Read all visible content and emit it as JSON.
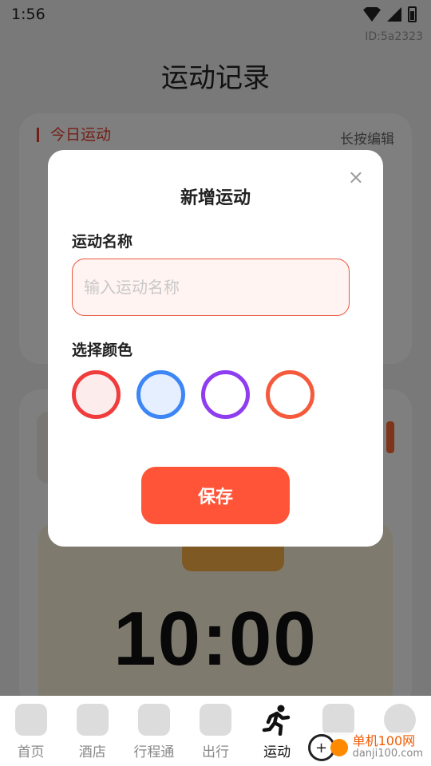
{
  "status_bar": {
    "time": "1:56"
  },
  "device_id": "ID:5a2323",
  "page": {
    "title": "运动记录",
    "card_today": {
      "title": "今日运动",
      "hint": "长按编辑"
    },
    "timer": {
      "value": "10:00"
    }
  },
  "modal": {
    "title": "新增运动",
    "close_symbol": "×",
    "name_label": "运动名称",
    "name_placeholder": "输入运动名称",
    "name_value": "",
    "color_label": "选择颜色",
    "colors": [
      {
        "border": "#f03c3c",
        "fill": "#fdecec",
        "selected": false
      },
      {
        "border": "#3d86f5",
        "fill": "#e6efff",
        "selected": false
      },
      {
        "border": "#8e3df0",
        "fill": "#ffffff",
        "selected": false
      },
      {
        "border": "#f55a3c",
        "fill": "#ffffff",
        "selected": false
      }
    ],
    "save_label": "保存"
  },
  "bottom_nav": {
    "items": [
      {
        "label": "首页",
        "icon": "home-icon"
      },
      {
        "label": "酒店",
        "icon": "hotel-icon"
      },
      {
        "label": "行程通",
        "icon": "itinerary-icon"
      },
      {
        "label": "出行",
        "icon": "luggage-icon"
      },
      {
        "label": "运动",
        "icon": "running-icon",
        "active": true
      },
      {
        "label": "",
        "icon": "calculator-icon"
      },
      {
        "label": "",
        "icon": "profile-icon"
      }
    ]
  },
  "watermark": {
    "line1": "单机100网",
    "line2": "danji100.com"
  }
}
